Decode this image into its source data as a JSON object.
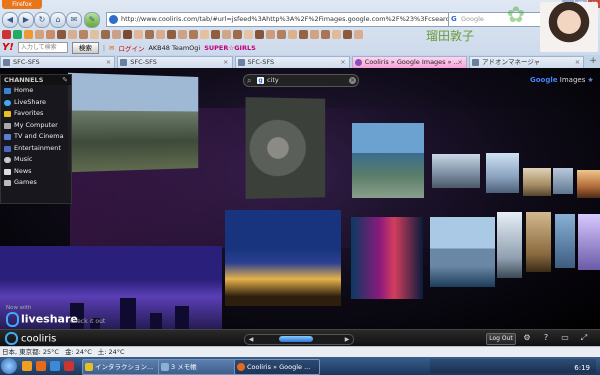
{
  "browser": {
    "app_button": "Firefox",
    "url": "http://www.cooliris.com/tab/#url=jsfeed%3Ahttp%3A%2F%2Fimages.google.com%2F%23%3Fcsearch%3...",
    "search_placeholder": "Google",
    "name_text": "瑠田敦子",
    "yahoo_label": "Y!",
    "search_input_placeholder": "入力して検索",
    "search_button": "検索",
    "login_label": "ログイン",
    "akb_label": "AKB48 TeamOgi",
    "super_label": "SUPER☆GIRLS",
    "tabs": [
      {
        "label": "SFC-SFS"
      },
      {
        "label": "SFC-SFS"
      },
      {
        "label": "SFC-SFS"
      },
      {
        "label": "Cooliris » Google Images » ..."
      },
      {
        "label": "アドオンマネージャ"
      }
    ],
    "new_tab": "+"
  },
  "cooliris": {
    "channels_title": "CHANNELS",
    "channels": [
      {
        "label": "Home",
        "color": "#3a82d8"
      },
      {
        "label": "LiveShare",
        "color": "#3fa9f5"
      },
      {
        "label": "Favorites",
        "color": "#e8c020"
      },
      {
        "label": "My Computer",
        "color": "#aaaaaa"
      },
      {
        "label": "TV and Cinema",
        "color": "#5a7fd8"
      },
      {
        "label": "Entertainment",
        "color": "#4a66c4"
      },
      {
        "label": "Music",
        "color": "#c9c9c9"
      },
      {
        "label": "News",
        "color": "#dddddd"
      },
      {
        "label": "Games",
        "color": "#bbbbbb"
      }
    ],
    "search_value": "city",
    "provider_prefix": "Google",
    "provider_suffix": "Images",
    "now_with": "Now with",
    "liveshare": "liveshare",
    "check_it_out": "check it out",
    "logo": "cooliris",
    "logout": "Log Out",
    "scroll_position": 0.45
  },
  "statusbar": {
    "items": [
      "日本, 東京都: 25°C",
      "金: 24°C",
      "土: 24°C"
    ]
  },
  "taskbar": {
    "tasks": [
      {
        "label": "インタラクション...",
        "active": false
      },
      {
        "label": "3 メモ帳",
        "active": false
      },
      {
        "label": "Cooliris » Google ...",
        "active": true
      }
    ],
    "time": "6:19"
  }
}
